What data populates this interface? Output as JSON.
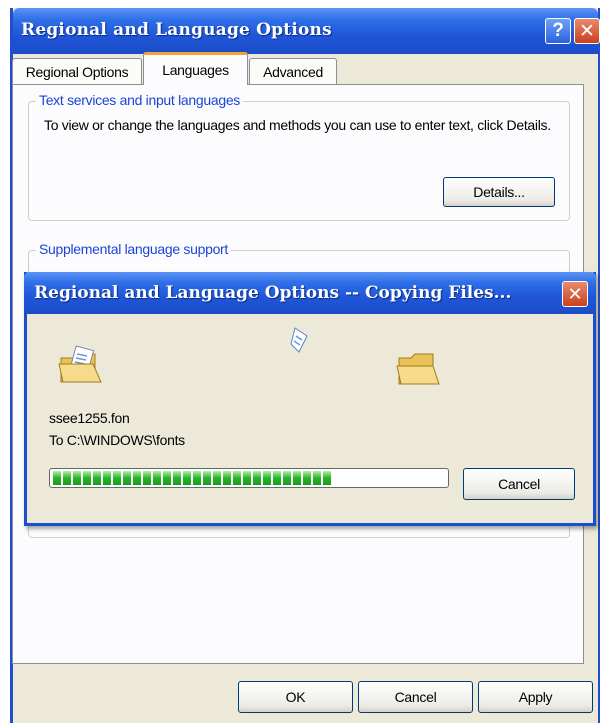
{
  "window": {
    "title": "Regional and Language Options",
    "help_glyph": "?",
    "close_glyph": "✕"
  },
  "tabs": [
    {
      "label": "Regional Options"
    },
    {
      "label": "Languages"
    },
    {
      "label": "Advanced"
    }
  ],
  "active_tab": "Languages",
  "text_services": {
    "legend": "Text services and input languages",
    "description": "To view or change the languages and methods you can use to enter text, click Details.",
    "details_button": "Details..."
  },
  "supplemental": {
    "legend": "Supplemental language support"
  },
  "copy_dialog": {
    "title": "Regional and Language Options -- Copying Files...",
    "close_glyph": "✕",
    "file_name": "ssee1255.fon",
    "destination": "To C:\\WINDOWS\\fonts",
    "progress_percent": 73,
    "cancel_button": "Cancel"
  },
  "footer": {
    "ok": "OK",
    "cancel": "Cancel",
    "apply": "Apply"
  },
  "colors": {
    "titlebar_blue": "#1f56d8",
    "legend_blue": "#1a44d8",
    "progress_green": "#27b42a",
    "active_tab_accent": "#f2a236"
  }
}
